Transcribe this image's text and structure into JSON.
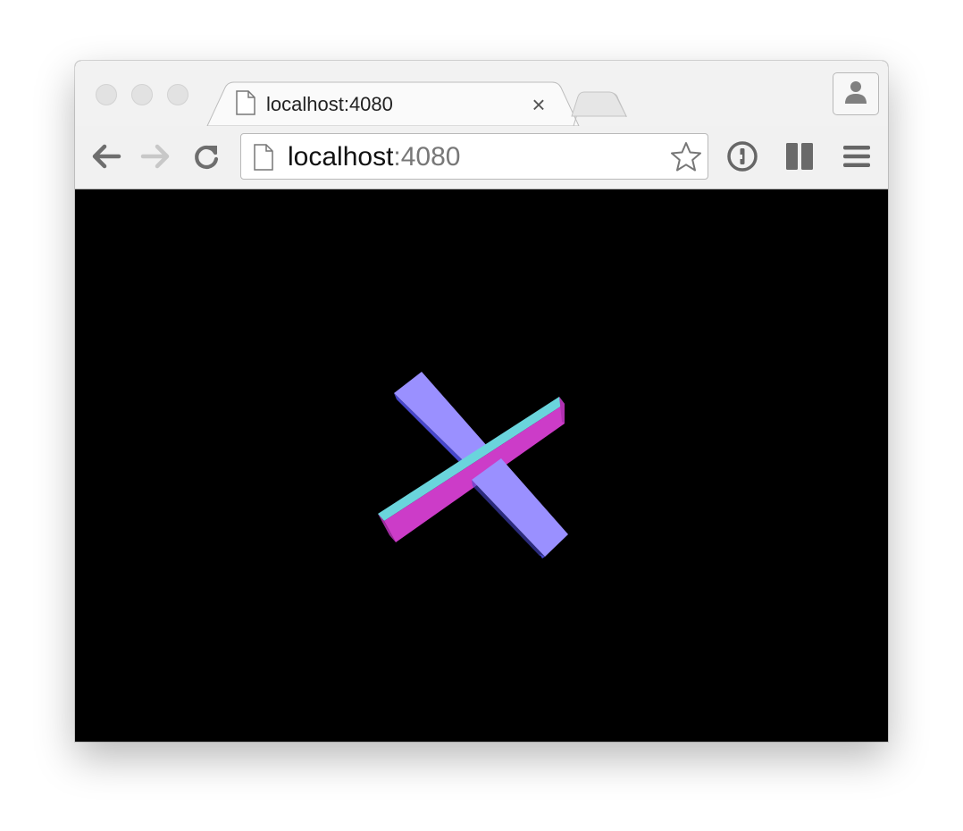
{
  "browser": {
    "tab": {
      "title": "localhost:4080",
      "close_glyph": "×",
      "icon": "page-icon"
    },
    "address_bar": {
      "host": "localhost",
      "port": ":4080",
      "page_icon": "page-icon",
      "bookmark_icon": "star-icon"
    },
    "toolbar": {
      "back_icon": "back-arrow-icon",
      "forward_icon": "forward-arrow-icon",
      "reload_icon": "reload-icon",
      "extension_icons": [
        "password-manager-icon",
        "reader-panel-icon"
      ],
      "menu_icon": "hamburger-menu-icon"
    },
    "profile_icon": "person-icon"
  },
  "content": {
    "background": "#000000",
    "scene": {
      "description_colors": {
        "bar_top": "#9a90ff",
        "bar_side": "#4a4ad0",
        "beam_top": "#6ad4dc",
        "beam_front": "#cc3cc8",
        "beam_end": "#a02ca0"
      }
    }
  }
}
